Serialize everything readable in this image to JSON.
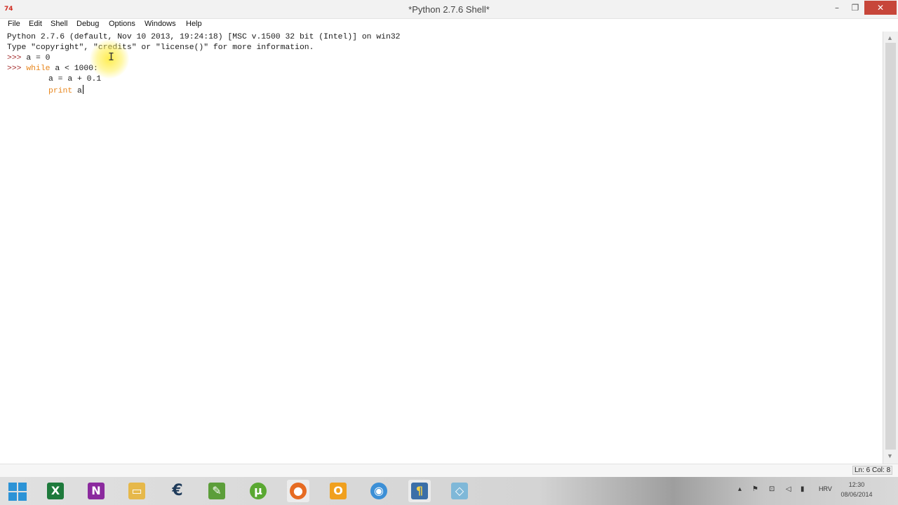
{
  "window": {
    "title": "*Python 2.7.6 Shell*",
    "app_icon": "74",
    "controls": {
      "minimize": "–",
      "maximize": "❐",
      "close": "✕"
    }
  },
  "menu": [
    "File",
    "Edit",
    "Shell",
    "Debug",
    "Options",
    "Windows",
    "Help"
  ],
  "editor": {
    "lines": {
      "l1": "Python 2.7.6 (default, Nov 10 2013, 19:24:18) [MSC v.1500 32 bit (Intel)] on win32",
      "l2": "Type \"copyright\", \"credits\" or \"license()\" for more information.",
      "l3_prompt": ">>> ",
      "l3_code": "a = 0",
      "l4_prompt": ">>> ",
      "l4_kw": "while",
      "l4_code": " a < 1000:",
      "l5_code": "a = a + 0.1",
      "l6_kw": "print",
      "l6_code": " a"
    }
  },
  "status": {
    "position": "Ln: 6 Col: 8"
  },
  "taskbar": {
    "icons": [
      "windows-start-icon",
      "excel-icon",
      "onenote-icon",
      "file-explorer-icon",
      "cashflow-app-icon",
      "notepad-icon",
      "utorrent-icon",
      "firefox-icon",
      "outlook-icon",
      "paint-icon",
      "python-idle-icon",
      "generic-app-icon"
    ],
    "lang": "HRV",
    "time": "12:30",
    "date": "08/06/2014"
  }
}
